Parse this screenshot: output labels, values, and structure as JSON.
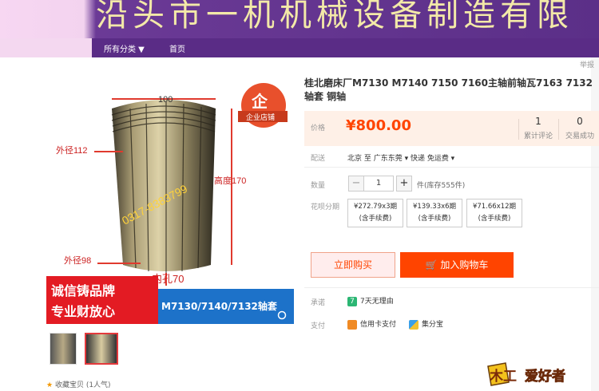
{
  "banner": {
    "text": "沿头市一机机械设备制造有限"
  },
  "nav": {
    "category": "所有分类 ▼",
    "home": "首页"
  },
  "report": "举报",
  "product": {
    "title": "桂北磨床厂M7130 M7140 7150 7160主轴前轴瓦7163 7132轴套 铜轴",
    "price_label": "价格",
    "price": "¥800.00",
    "review_count": "1",
    "review_label": "累计评论",
    "deal_count": "0",
    "deal_label": "交易成功"
  },
  "image": {
    "dim_top": "100",
    "outer_diameter_1": "外径112",
    "height": "高度170",
    "outer_diameter_2": "外径98",
    "inner_hole": "内孔70",
    "phone": "0317-8383799",
    "shop_badge": "企业店铺",
    "slogan_1": "诚信铸品牌",
    "slogan_2": "专业财放心",
    "model_caption": "M7130/7140/7132轴套"
  },
  "delivery": {
    "label": "配送",
    "text": "北京 至  广东东莞 ▾   快递 免运费 ▾"
  },
  "quantity": {
    "label": "数量",
    "value": "1",
    "minus": "−",
    "plus": "+",
    "stock": "件(库存555件)"
  },
  "installment": {
    "label": "花呗分期",
    "options": [
      {
        "line1": "¥272.79x3期",
        "line2": "(含手续费)"
      },
      {
        "line1": "¥139.33x6期",
        "line2": "(含手续费)"
      },
      {
        "line1": "¥71.66x12期",
        "line2": "(含手续费)"
      }
    ]
  },
  "buttons": {
    "buy": "立即购买",
    "cart": "加入购物车"
  },
  "promise": {
    "label": "承诺",
    "text": "7天无理由",
    "icon_char": "7"
  },
  "payment": {
    "label": "支付",
    "option1": "信用卡支付",
    "option2": "集分宝"
  },
  "favorite": {
    "star": "★",
    "text": "收藏宝贝 (1人气)"
  },
  "watermark": {
    "left": "木工",
    "right": "爱好者"
  },
  "colors": {
    "accent": "#ff4400",
    "nav_bg": "#5a2c86",
    "banner_text": "#f3e9a8"
  }
}
